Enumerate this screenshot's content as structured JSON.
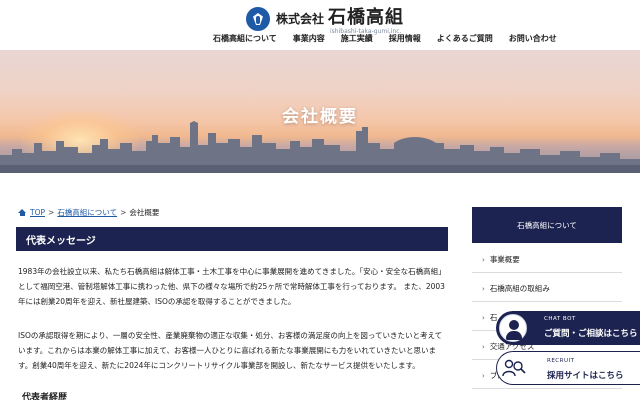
{
  "header": {
    "logo_prefix": "株式会社",
    "logo_name": "石橋高組",
    "logo_roman": "ishibashi-taka-gumi,inc.",
    "nav": [
      {
        "label": "石橋高組について"
      },
      {
        "label": "事業内容"
      },
      {
        "label": "施工実績"
      },
      {
        "label": "採用情報"
      },
      {
        "label": "よくあるご質問"
      },
      {
        "label": "お問い合わせ"
      }
    ]
  },
  "hero": {
    "title": "会社概要"
  },
  "breadcrumb": {
    "home": "TOP",
    "sep": ">",
    "parent": "石橋高組について",
    "current": "会社概要"
  },
  "main": {
    "section_title": "代表メッセージ",
    "paragraph1": "1983年の会社設立以来、私たち石橋高組は解体工事・土木工事を中心に事業展開を進めてきました。「安心・安全な石橋高組」として福岡空港、管制塔解体工事に携わった他、県下の様々な場所で約25ヶ所で常時解体工事を行っております。 また、2003年には創業20周年を迎え、新社屋建築、ISOの承認を取得することができました。",
    "paragraph2": "ISOの承認取得を期により、一層の安全性、産業廃棄物の適正な収集・処分、お客様の満足度の向上を図っていきたいと考えています。これからは本業の解体工事に加えて、お客様一人ひとりに喜ばれる新たな事業展開にも力をいれていきたいと思います。創業40周年を迎え、新たに2024年にコンクリートリサイクル事業部を開設し、新たなサービス提供をいたします。",
    "sub_heading": "代表者経歴"
  },
  "sidebar": {
    "title": "石橋高組について",
    "items": [
      {
        "label": "事業概要"
      },
      {
        "label": "石橋高組の取組み"
      },
      {
        "label": "石"
      },
      {
        "label": "交通アクセス"
      },
      {
        "label": "ブロ"
      }
    ]
  },
  "floating": {
    "chat_top": "CHAT BOT",
    "chat_main": "ご質問・ご相談はこちら",
    "recruit_top": "RECRUIT",
    "recruit_main": "採用サイトはこちら"
  },
  "colors": {
    "navy": "#1c2350",
    "brand_blue": "#1f5aa6"
  }
}
